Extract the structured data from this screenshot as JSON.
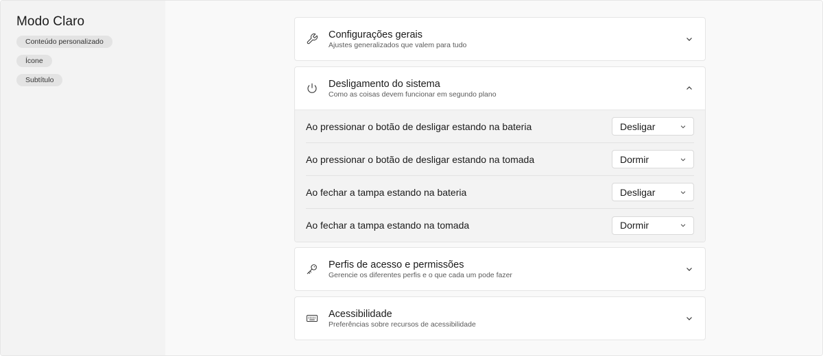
{
  "sidebar": {
    "title": "Modo Claro",
    "chips": [
      "Conteúdo personalizado",
      "Ícone",
      "Subtítulo"
    ]
  },
  "cards": [
    {
      "title": "Configurações gerais",
      "subtitle": "Ajustes generalizados que valem para tudo",
      "icon": "wrench-icon",
      "expanded": false
    },
    {
      "title": "Desligamento do sistema",
      "subtitle": "Como as coisas devem funcionar em segundo plano",
      "icon": "power-icon",
      "expanded": true,
      "settings": [
        {
          "label": "Ao pressionar o botão de desligar estando na bateria",
          "value": "Desligar"
        },
        {
          "label": "Ao pressionar o botão de desligar estando na tomada",
          "value": "Dormir"
        },
        {
          "label": "Ao fechar a tampa estando na bateria",
          "value": "Desligar"
        },
        {
          "label": "Ao fechar a tampa estando na tomada",
          "value": "Dormir"
        }
      ]
    },
    {
      "title": "Perfis de acesso e permissões",
      "subtitle": "Gerencie os diferentes perfis e o que cada um pode fazer",
      "icon": "key-icon",
      "expanded": false
    },
    {
      "title": "Acessibilidade",
      "subtitle": "Preferências sobre recursos de acessibilidade",
      "icon": "keyboard-icon",
      "expanded": false
    }
  ]
}
